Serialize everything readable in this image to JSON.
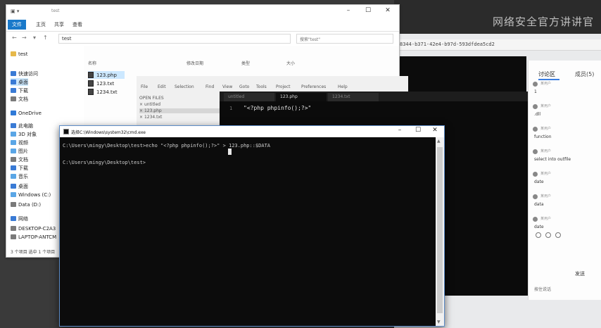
{
  "browser": {
    "watermark": "网络安全官方讲讲官",
    "url_fragment": "8344-b371-42e4-b97d-593dfdea5cd2",
    "chat": {
      "tab_active": "讨论区",
      "tab_other": "成员(5)",
      "messages": [
        {
          "meta": "某用户",
          "text": "1"
        },
        {
          "meta": "某用户",
          "text": ".dll"
        },
        {
          "meta": "某用户",
          "text": "function"
        },
        {
          "meta": "某用户",
          "text": "select into outfile"
        },
        {
          "meta": "某用户",
          "text": "date"
        },
        {
          "meta": "某用户",
          "text": "data"
        },
        {
          "meta": "某用户",
          "text": "date"
        }
      ],
      "send": "发送",
      "bottom": "按住说话"
    }
  },
  "explorer": {
    "title": "test",
    "ribbon_tabs": [
      "文件",
      "主页",
      "共享",
      "查看"
    ],
    "address": "test",
    "search_placeholder": "搜索\"test\"",
    "sidebar": [
      {
        "label": "test",
        "color": "#e6b84a"
      },
      {
        "label": "快速访问",
        "color": "#3a7bd5"
      },
      {
        "label": "桌面",
        "color": "#3a7bd5"
      },
      {
        "label": "下载",
        "color": "#3a7bd5"
      },
      {
        "label": "文档",
        "color": "#7a7a7a"
      },
      {
        "label": "OneDrive",
        "color": "#2f7ad7"
      },
      {
        "label": "此电脑",
        "color": "#3a7bd5"
      },
      {
        "label": "3D 对象",
        "color": "#5aa6e6"
      },
      {
        "label": "视频",
        "color": "#5aa6e6"
      },
      {
        "label": "图片",
        "color": "#5aa6e6"
      },
      {
        "label": "文档",
        "color": "#7a7a7a"
      },
      {
        "label": "下载",
        "color": "#3a7bd5"
      },
      {
        "label": "音乐",
        "color": "#5aa6e6"
      },
      {
        "label": "桌面",
        "color": "#3a7bd5"
      },
      {
        "label": "Windows (C:)",
        "color": "#5aa6e6"
      },
      {
        "label": "Data (D:)",
        "color": "#7a7a7a"
      },
      {
        "label": "网络",
        "color": "#3a7bd5"
      },
      {
        "label": "DESKTOP-C2A3",
        "color": "#7a7a7a"
      },
      {
        "label": "LAPTOP-ANTCM",
        "color": "#7a7a7a"
      }
    ],
    "columns": [
      "名称",
      "修改日期",
      "类型",
      "大小"
    ],
    "files": [
      "123.php",
      "123.txt",
      "1234.txt"
    ],
    "status": "3 个项目    选中 1 个项目"
  },
  "editor": {
    "menu": [
      "File",
      "Edit",
      "Selection",
      "Find",
      "View",
      "Goto",
      "Tools",
      "Project",
      "Preferences",
      "Help"
    ],
    "open_files_header": "OPEN FILES",
    "open_files": [
      "untitled",
      "123.php",
      "1234.txt"
    ]
  },
  "dark_editor": {
    "tabs": [
      "untitled",
      "123.php",
      "1234.txt"
    ],
    "line_number": "1",
    "code": "\"<?php phpinfo();?>\""
  },
  "cmd": {
    "title": "选择C:\\Windows\\system32\\cmd.exe",
    "line1": "C:\\Users\\mingy\\Desktop\\test>echo \"<?php phpinfo();?>\" > 123.php::$DATA",
    "line2": "C:\\Users\\mingy\\Desktop\\test>"
  }
}
